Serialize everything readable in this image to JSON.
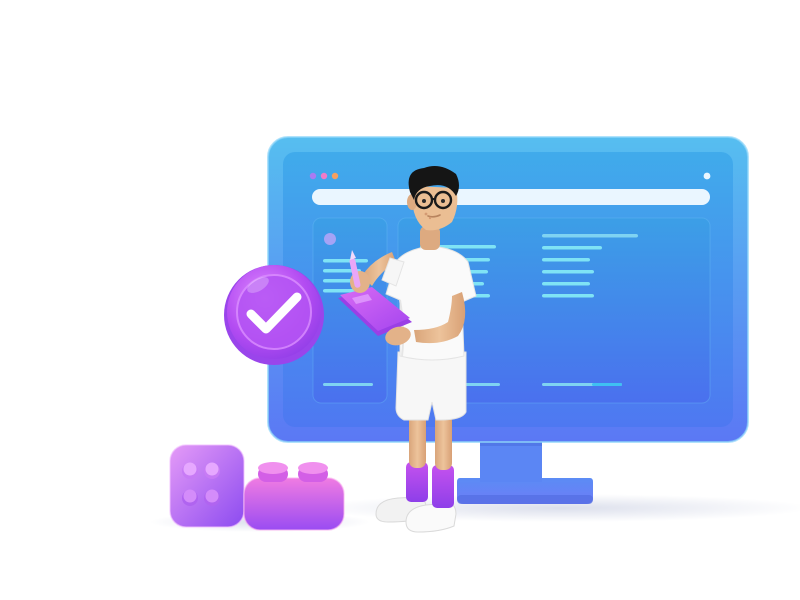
{
  "illustration": {
    "subject": "3d-person-with-clipboard-in-front-of-monitor",
    "icons": [
      "check-badge-icon",
      "toy-brick-icon",
      "toy-brick-icon",
      "clipboard-icon",
      "pencil-icon"
    ],
    "colors": {
      "monitor_top": "#4FB8EE",
      "monitor_bottom": "#5A7CF5",
      "screen_top": "#3DA8EC",
      "screen_bottom": "#4F7CF2",
      "accent_purple": "#B44DF0",
      "accent_magenta": "#E14FD9",
      "bar_light": "#EAF6FF",
      "shirt": "#FAFAFA",
      "skin": "#E6B98F",
      "hair": "#151515",
      "socks": "#B548EA",
      "dot_purple": "#A97BF2",
      "dot_pink": "#F07BC8",
      "dot_orange": "#F5A061"
    }
  }
}
